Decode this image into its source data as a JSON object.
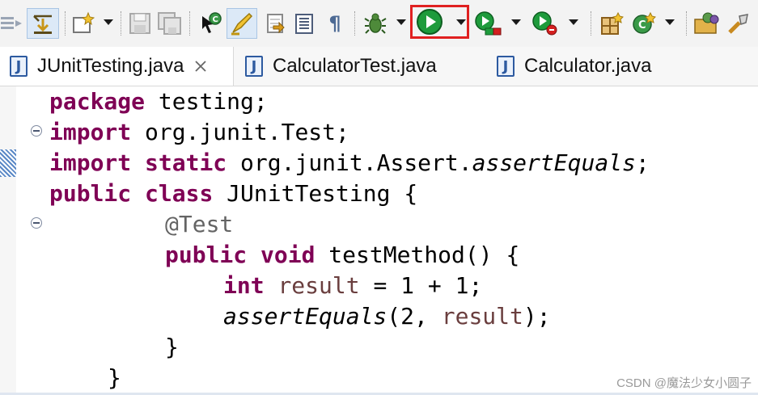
{
  "toolbar": {
    "icons": [
      "overflow-menu-icon",
      "link-editor-icon",
      "new-file-icon",
      "save-icon",
      "save-all-icon",
      "open-type-icon",
      "highlight-icon",
      "apply-patch-icon",
      "outline-icon",
      "show-whitespace-icon",
      "debug-icon",
      "run-icon",
      "coverage-icon",
      "profile-icon",
      "new-package-icon",
      "new-class-icon",
      "open-folder-icon",
      "search-tool-icon"
    ],
    "whitespace_glyph": "¶",
    "run_highlight_color": "#e02020",
    "run_green": "#1e9b3c"
  },
  "tabs": [
    {
      "label": "JUnitTesting.java",
      "active": true,
      "icon": "J"
    },
    {
      "label": "CalculatorTest.java",
      "active": false,
      "icon": "J"
    },
    {
      "label": "Calculator.java",
      "active": false,
      "icon": "J"
    }
  ],
  "code": {
    "line1": {
      "kw": "package",
      "rest": " testing;"
    },
    "line2": {
      "kw": "import",
      "rest": " org.junit.Test;"
    },
    "line3": {
      "kw1": "import",
      "sp": " ",
      "kw2": "static",
      "rest": " org.junit.Assert.",
      "method": "assertEquals",
      "end": ";"
    },
    "line4": {
      "kw1": "public",
      "sp": " ",
      "kw2": "class",
      "rest": " JUnitTesting {"
    },
    "line5": {
      "annotation": "@Test"
    },
    "line6": {
      "kw1": "public",
      "sp": " ",
      "kw2": "void",
      "rest": " testMethod() {"
    },
    "line7": {
      "kw": "int",
      "sp": " ",
      "var": "result",
      "rest": " = 1 + 1;"
    },
    "line8": {
      "method": "assertEquals",
      "mid": "(2, ",
      "var": "result",
      "end": ");"
    },
    "line9": {
      "text": "}"
    },
    "line10": {
      "text": "}"
    }
  },
  "watermark": "CSDN @魔法少女小圆子"
}
